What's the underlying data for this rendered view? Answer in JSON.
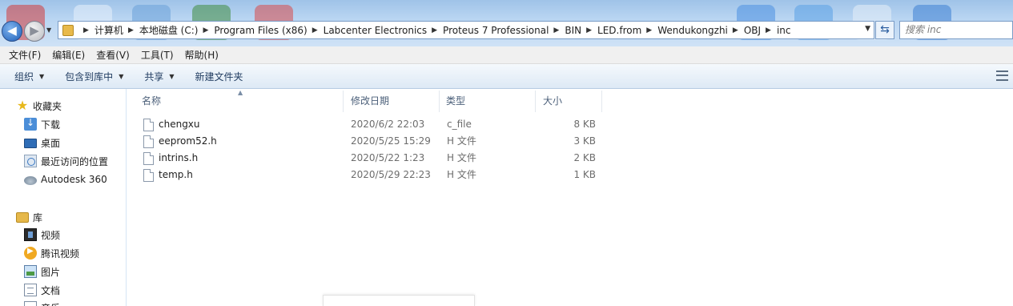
{
  "address_bar": {
    "breadcrumbs": [
      "计算机",
      "本地磁盘 (C:)",
      "Program Files (x86)",
      "Labcenter Electronics",
      "Proteus 7 Professional",
      "BIN",
      "LED.from",
      "Wendukongzhi",
      "OBJ",
      "inc"
    ]
  },
  "search": {
    "placeholder": "搜索 inc"
  },
  "menu": [
    "文件(F)",
    "编辑(E)",
    "查看(V)",
    "工具(T)",
    "帮助(H)"
  ],
  "commands": {
    "organize": "组织",
    "include_in_library": "包含到库中",
    "share": "共享",
    "new_folder": "新建文件夹"
  },
  "nav": {
    "favorites": "收藏夹",
    "downloads": "下载",
    "desktop": "桌面",
    "recent": "最近访问的位置",
    "autodesk": "Autodesk 360",
    "libraries": "库",
    "videos": "视频",
    "tencent_video": "腾讯视频",
    "pictures": "图片",
    "documents": "文档",
    "music": "音乐"
  },
  "columns": {
    "name": "名称",
    "date": "修改日期",
    "type": "类型",
    "size": "大小"
  },
  "files": [
    {
      "name": "chengxu",
      "date": "2020/6/2 22:03",
      "type": "c_file",
      "size": "8 KB"
    },
    {
      "name": "eeprom52.h",
      "date": "2020/5/25 15:29",
      "type": "H 文件",
      "size": "3 KB"
    },
    {
      "name": "intrins.h",
      "date": "2020/5/22 1:23",
      "type": "H 文件",
      "size": "2 KB"
    },
    {
      "name": "temp.h",
      "date": "2020/5/29 22:23",
      "type": "H 文件",
      "size": "1 KB"
    }
  ]
}
